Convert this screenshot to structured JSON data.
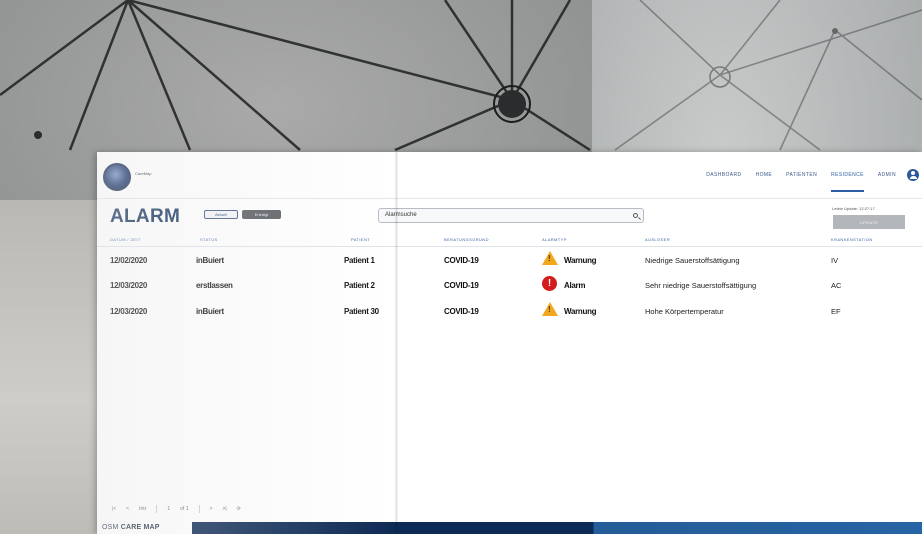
{
  "header": {
    "logo_text": "CareMap",
    "nav": [
      "DASHBOARD",
      "HOME",
      "PATIENTEN",
      "RESIDENCE",
      "ADMIN"
    ],
    "active_nav": 3
  },
  "page": {
    "title": "ALARM",
    "filter_a": "Aktuell",
    "filter_b": "Erledigt",
    "search_placeholder": "Alarmsuche",
    "update_label": "Letzte Update: 12:27:17",
    "update_button": "UPDATE"
  },
  "table": {
    "columns": [
      "DATUM / ZEIT",
      "STATUS",
      "PATIENT",
      "BERATUNGSGRUND",
      "ALARMTYP",
      "AUSLÖSER",
      "KRANKENSTATION"
    ],
    "rows": [
      {
        "date": "12/02/2020",
        "status": "inBuiert",
        "patient": "Patient 1",
        "reason": "COVID-19",
        "type": "warning",
        "type_label": "Warnung",
        "trigger": "Niedrige Sauerstoffsättigung",
        "station": "IV"
      },
      {
        "date": "12/03/2020",
        "status": "erstlassen",
        "patient": "Patient 2",
        "reason": "COVID-19",
        "type": "alarm",
        "type_label": "Alarm",
        "trigger": "Sehr niedrige Sauerstoffsättigung",
        "station": "AC"
      },
      {
        "date": "12/03/2020",
        "status": "inBuiert",
        "patient": "Patient 30",
        "reason": "COVID-19",
        "type": "warning",
        "type_label": "Warnung",
        "trigger": "Hohe Körpertemperatur",
        "station": "EF"
      }
    ]
  },
  "pager": {
    "first": "|<",
    "prev": "<",
    "size": "Intr",
    "page": "1",
    "of": "of 1",
    "next": ">",
    "last": ">|",
    "refresh": "⟳"
  },
  "footer": {
    "brand_prefix": "OSM",
    "brand_name": "CARE MAP"
  },
  "colors": {
    "title": "#16345f",
    "nav": "#3d5a8a",
    "header_text": "#3b63a6",
    "warning": "#f2a81d",
    "alarm": "#d51c1c",
    "footer_dark": "#0d2a55",
    "footer_light": "#2764a4"
  }
}
